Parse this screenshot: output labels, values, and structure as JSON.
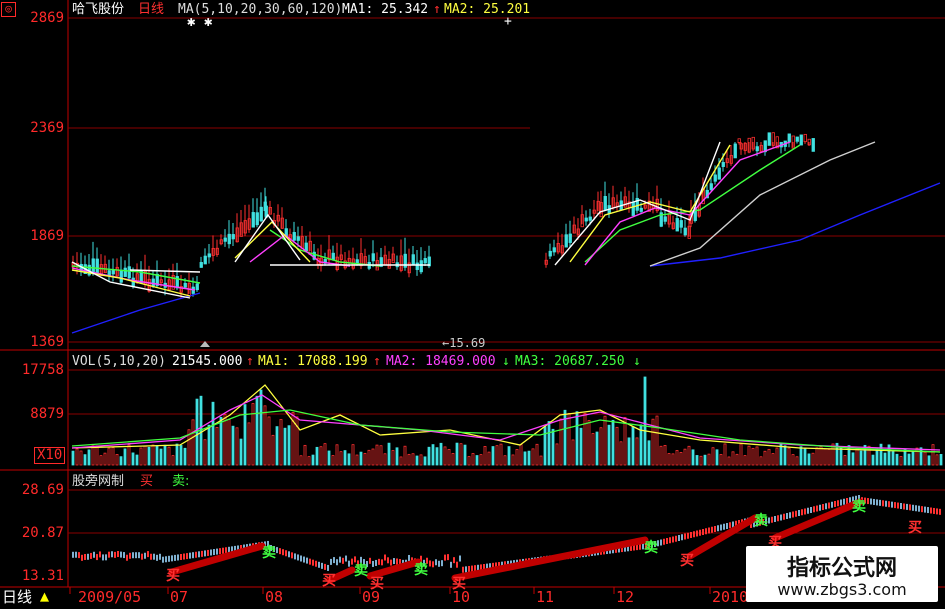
{
  "colors": {
    "up": "#ff3030",
    "down": "#40e0e0",
    "ma5": "#ffffff",
    "ma10": "#ffff40",
    "ma20": "#ff40ff",
    "ma30": "#40ff40",
    "ma60": "#d0d0d0",
    "ma120": "#2020ff",
    "grid": "#a00000",
    "buy": "#ff3030",
    "sell": "#40ff40",
    "band": "#c00000"
  },
  "header": {
    "stock_name": "哈飞股份",
    "period": "日线",
    "ma_label": "MA(5,10,20,30,60,120)",
    "ma1": "MA1: 25.342",
    "ma2": "MA2: 25.201",
    "cursor_icon": "cross-cursor-icon"
  },
  "price_panel": {
    "y_ticks": [
      "2869",
      "2369",
      "1869",
      "1369"
    ],
    "annotation": "←15.69",
    "y_range": [
      1369,
      2869
    ]
  },
  "volume_panel": {
    "title": "VOL(5,10,20)",
    "value": "21545.000",
    "ma1": "MA1: 17088.199",
    "ma2": "MA2: 18469.000",
    "ma3": "MA3: 20687.250",
    "y_ticks": [
      "17758",
      "8879"
    ],
    "multiplier": "X10",
    "y_range": [
      0,
      17758
    ]
  },
  "signal_panel": {
    "title": "股旁网制",
    "buy_label": "买",
    "sell_label": "卖:",
    "y_ticks": [
      "28.69",
      "20.87",
      "13.31"
    ],
    "y_range": [
      13.31,
      28.69
    ]
  },
  "x_axis": {
    "labels": [
      "2009/05",
      "07",
      "08",
      "09",
      "10",
      "11",
      "12",
      "2010"
    ]
  },
  "footer": {
    "period_tab": "日线",
    "scroll_icon": "triangle-up-icon"
  },
  "watermark": {
    "title": "指标公式网",
    "url": "www.zbgs3.com"
  },
  "signals": [
    {
      "type": "buy",
      "label": "买"
    },
    {
      "type": "sell",
      "label": "卖"
    },
    {
      "type": "buy",
      "label": "买"
    },
    {
      "type": "sell",
      "label": "卖"
    },
    {
      "type": "buy",
      "label": "买"
    },
    {
      "type": "sell",
      "label": "卖"
    },
    {
      "type": "buy",
      "label": "买"
    },
    {
      "type": "sell",
      "label": "卖"
    },
    {
      "type": "buy",
      "label": "买"
    },
    {
      "type": "sell",
      "label": "卖"
    },
    {
      "type": "buy",
      "label": "买"
    },
    {
      "type": "sell",
      "label": "卖"
    },
    {
      "type": "buy",
      "label": "买"
    }
  ]
}
